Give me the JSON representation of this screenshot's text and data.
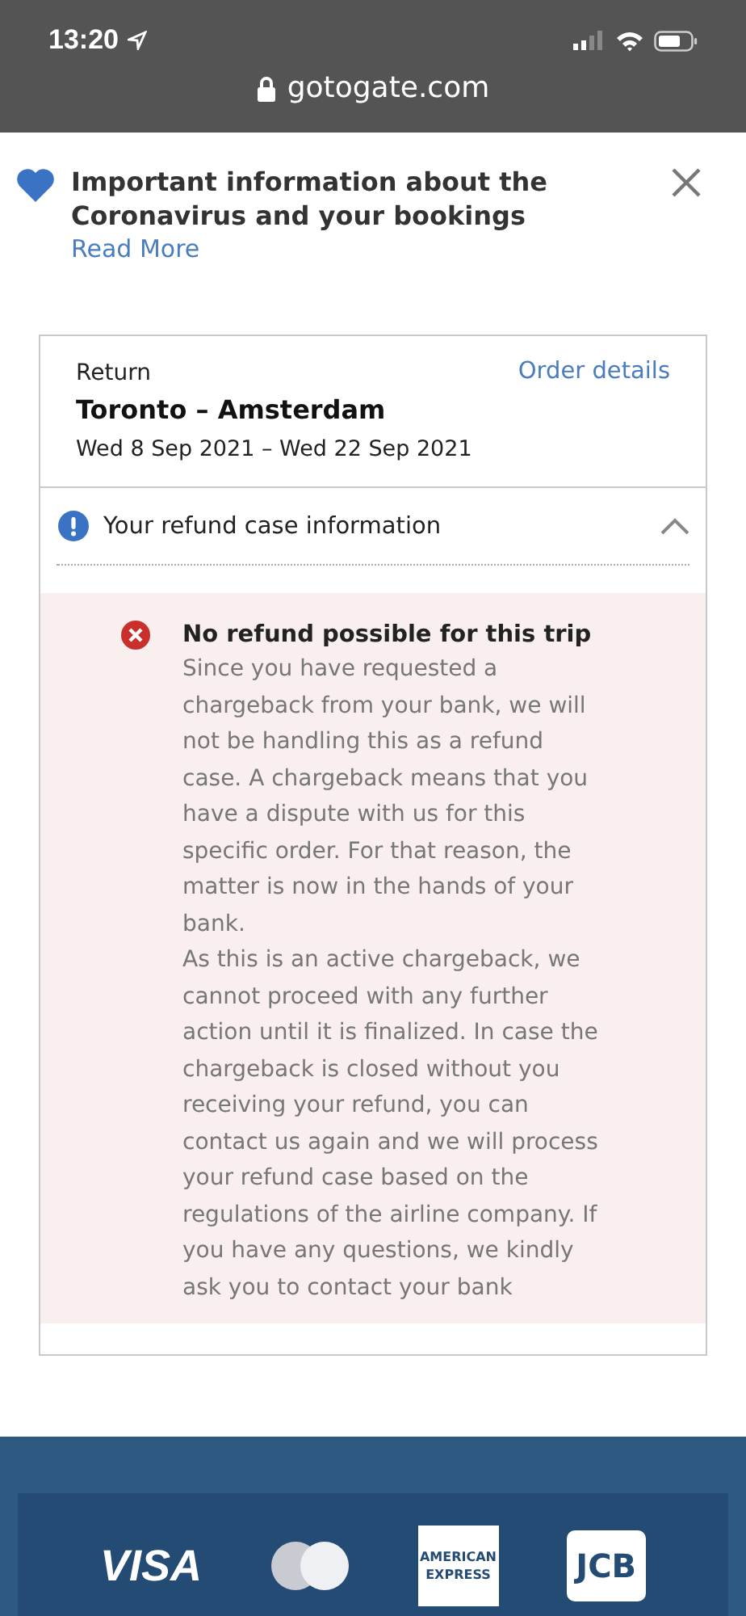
{
  "status_bar": {
    "time": "13:20",
    "url": "gotogate.com"
  },
  "notice": {
    "title": "Important information about the Coronavirus and your bookings",
    "link": "Read More"
  },
  "booking": {
    "trip_type": "Return",
    "route": "Toronto – Amsterdam",
    "dates": "Wed 8 Sep 2021 – Wed 22 Sep 2021",
    "link": "Order details"
  },
  "refund_section": {
    "title": "Your refund case information",
    "expanded": true,
    "message": {
      "title": "No refund possible for this trip",
      "paragraphs": [
        "Since you have requested a chargeback from your bank, we will not be handling this as a refund case. A chargeback means that you have a dispute with us for this specific order. For that reason, the matter is now in the hands of your bank.",
        "As this is an active chargeback, we cannot proceed with any further action until it is finalized. In case the chargeback is closed without you receiving your refund, you can contact us again and we will process your refund case based on the regulations of the airline company. If you have any questions, we kindly ask you to contact your bank"
      ]
    }
  },
  "payment_logos": [
    {
      "kind": "visa",
      "text": "VISA"
    },
    {
      "kind": "mastercard"
    },
    {
      "kind": "amex",
      "text": "AMERICAN EXPRESS"
    },
    {
      "kind": "jcb",
      "text": "JCB"
    }
  ]
}
